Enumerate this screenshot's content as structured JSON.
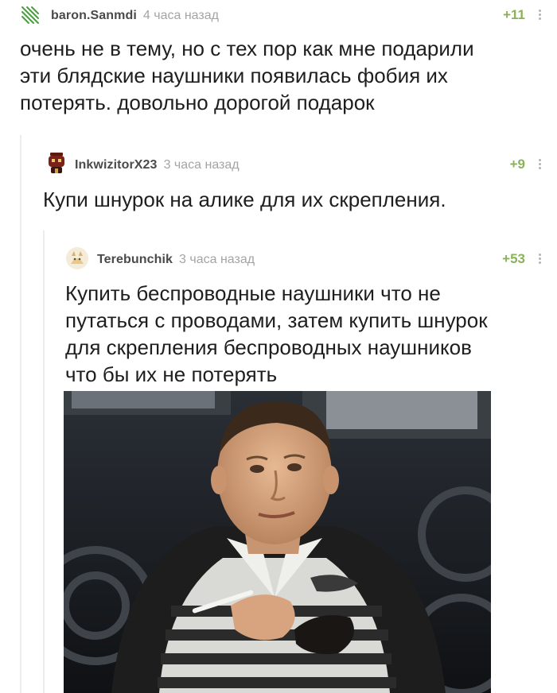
{
  "comments": [
    {
      "author": "baron.Sanmdi",
      "time": "4 часа назад",
      "rating": "+11",
      "text": "очень не в тему, но с тех пор как мне подарили\nэти блядские наушники появилась фобия их\nпотерять. довольно дорогой подарок",
      "avatar_icon": "leaf-stripes-icon"
    },
    {
      "author": "InkwizitorX23",
      "time": "3 часа назад",
      "rating": "+9",
      "text": "Купи шнурок на алике для их скрепления.",
      "avatar_icon": "inquisitor-helmet-icon"
    },
    {
      "author": "Terebunchik",
      "time": "3 часа назад",
      "rating": "+53",
      "text": "Купить беспроводные наушники что не\nпутаться с проводами, затем купить шнурок\nдля скрепления беспроводных наушников\nчто бы их не потерять",
      "avatar_icon": "cat-icon",
      "image": "photo of a man in a striped shirt holding a cigarette"
    }
  ],
  "colors": {
    "rating": "#8ab25a",
    "author": "#4a4a4a",
    "time": "#a4a4a4",
    "text": "#1e1e1e",
    "thread_line": "#ececec"
  }
}
